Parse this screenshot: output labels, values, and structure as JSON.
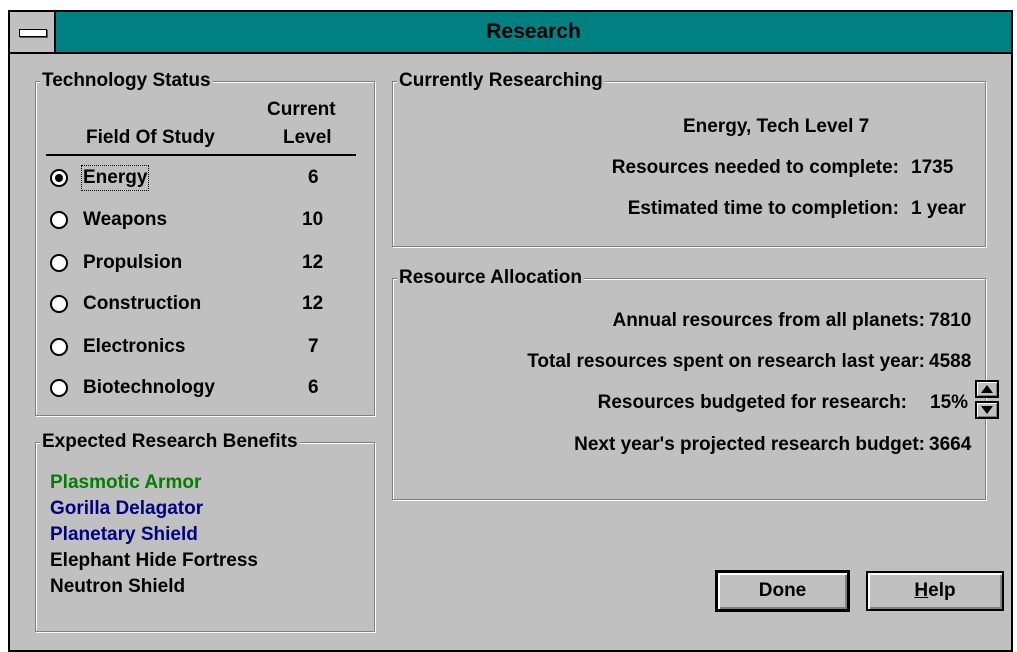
{
  "window": {
    "title": "Research"
  },
  "tech_status": {
    "legend": "Technology Status",
    "header_field": "Field Of Study",
    "header_level_1": "Current",
    "header_level_2": "Level",
    "fields": [
      {
        "name": "Energy",
        "level": "6",
        "selected": true
      },
      {
        "name": "Weapons",
        "level": "10",
        "selected": false
      },
      {
        "name": "Propulsion",
        "level": "12",
        "selected": false
      },
      {
        "name": "Construction",
        "level": "12",
        "selected": false
      },
      {
        "name": "Electronics",
        "level": "7",
        "selected": false
      },
      {
        "name": "Biotechnology",
        "level": "6",
        "selected": false
      }
    ]
  },
  "benefits": {
    "legend": "Expected Research Benefits",
    "items": [
      {
        "text": "Plasmotic Armor",
        "color": "#008000"
      },
      {
        "text": "Gorilla Delagator",
        "color": "#000080"
      },
      {
        "text": "Planetary Shield",
        "color": "#000080"
      },
      {
        "text": "Elephant Hide Fortress",
        "color": "#000000"
      },
      {
        "text": "Neutron Shield",
        "color": "#000000"
      }
    ]
  },
  "current": {
    "legend": "Currently Researching",
    "summary": "Energy, Tech Level 7",
    "needed_label": "Resources needed to complete:",
    "needed_value": "1735",
    "eta_label": "Estimated time to completion:",
    "eta_value": "1 year"
  },
  "allocation": {
    "legend": "Resource Allocation",
    "annual_label": "Annual resources from all planets:",
    "annual_value": "7810",
    "spent_label": "Total resources spent on research last year:",
    "spent_value": "4588",
    "budget_label": "Resources budgeted for research:",
    "budget_value": "15%",
    "projected_label": "Next year's projected research budget:",
    "projected_value": "3664"
  },
  "buttons": {
    "done": "Done",
    "help_accel": "H",
    "help_rest": "elp"
  }
}
